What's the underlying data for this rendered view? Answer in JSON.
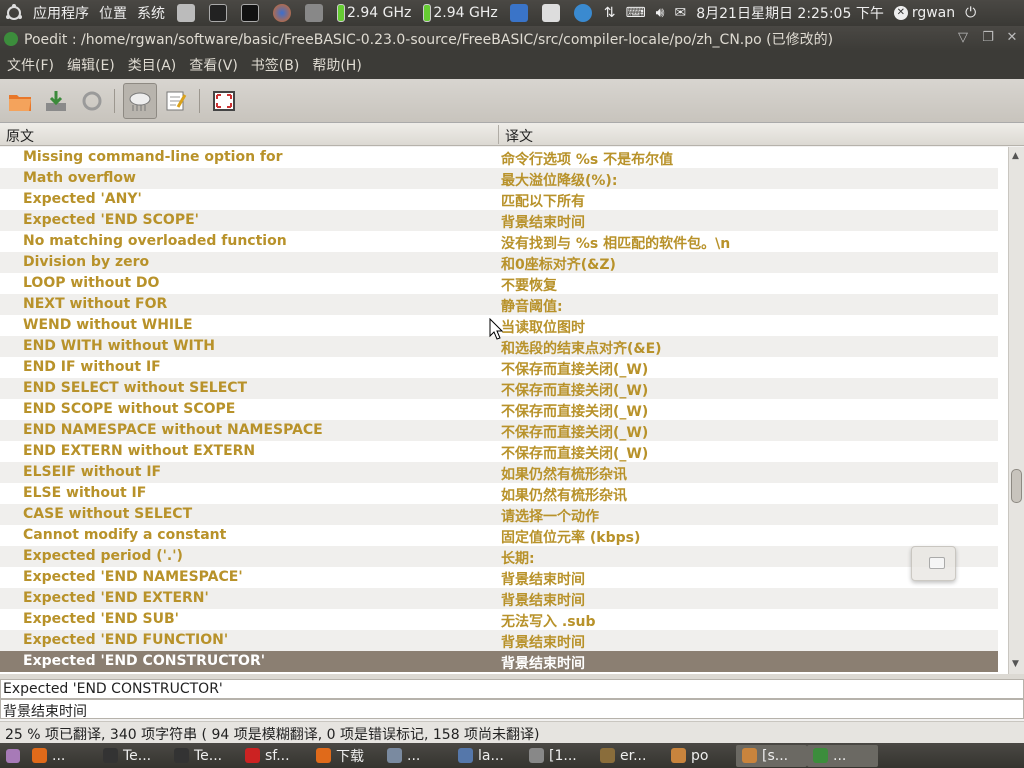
{
  "top_panel": {
    "menus": [
      "应用程序",
      "位置",
      "系统"
    ],
    "cpu1": "2.94 GHz",
    "cpu2": "2.94 GHz",
    "clock": "8月21日星期日  2:25:05 下午",
    "user": "rgwan"
  },
  "window": {
    "title": "Poedit : /home/rgwan/software/basic/FreeBASIC-0.23.0-source/FreeBASIC/src/compiler-locale/po/zh_CN.po (已修改的)"
  },
  "menubar": {
    "items": [
      "文件(F)",
      "编辑(E)",
      "类目(A)",
      "查看(V)",
      "书签(B)",
      "帮助(H)"
    ]
  },
  "columns": {
    "source": "原文",
    "translation": "译文"
  },
  "rows": [
    {
      "src": "Missing command-line option for",
      "tr": "命令行选项 %s 不是布尔值"
    },
    {
      "src": "Math overflow",
      "tr": "最大溢位降级(%):"
    },
    {
      "src": "Expected 'ANY'",
      "tr": "匹配以下所有"
    },
    {
      "src": "Expected 'END SCOPE'",
      "tr": "背景结束时间"
    },
    {
      "src": "No matching overloaded function",
      "tr": "没有找到与 %s 相匹配的软件包。\\n"
    },
    {
      "src": "Division by zero",
      "tr": "和0座标对齐(&Z)"
    },
    {
      "src": "LOOP without DO",
      "tr": "不要恢复"
    },
    {
      "src": "NEXT without FOR",
      "tr": "静音阈值:"
    },
    {
      "src": "WEND without WHILE",
      "tr": "当读取位图时"
    },
    {
      "src": "END WITH without WITH",
      "tr": "和选段的结束点对齐(&E)"
    },
    {
      "src": "END IF without IF",
      "tr": "不保存而直接关闭(_W)"
    },
    {
      "src": "END SELECT without SELECT",
      "tr": "不保存而直接关闭(_W)"
    },
    {
      "src": "END SCOPE without SCOPE",
      "tr": "不保存而直接关闭(_W)"
    },
    {
      "src": "END NAMESPACE without NAMESPACE",
      "tr": "不保存而直接关闭(_W)"
    },
    {
      "src": "END EXTERN without EXTERN",
      "tr": "不保存而直接关闭(_W)"
    },
    {
      "src": "ELSEIF without IF",
      "tr": "如果仍然有梳形杂讯"
    },
    {
      "src": "ELSE without IF",
      "tr": "如果仍然有梳形杂讯"
    },
    {
      "src": "CASE without SELECT",
      "tr": "请选择一个动作"
    },
    {
      "src": "Cannot modify a constant",
      "tr": "固定值位元率 (kbps)"
    },
    {
      "src": "Expected period ('.')",
      "tr": "长期:"
    },
    {
      "src": "Expected 'END NAMESPACE'",
      "tr": "背景结束时间"
    },
    {
      "src": "Expected 'END EXTERN'",
      "tr": "背景结束时间"
    },
    {
      "src": "Expected 'END SUB'",
      "tr": "无法写入 .sub"
    },
    {
      "src": "Expected 'END FUNCTION'",
      "tr": "背景结束时间"
    },
    {
      "src": "Expected 'END CONSTRUCTOR'",
      "tr": "背景结束时间",
      "selected": true
    }
  ],
  "editor": {
    "source_text": "Expected 'END CONSTRUCTOR'",
    "translation_text": "背景结束时间"
  },
  "status": "25 % 项已翻译, 340 项字符串 ( 94 项是模糊翻译, 0 项是错误标记, 158 项尚未翻译)",
  "taskbar": {
    "items": [
      {
        "icon": "firefox-icon",
        "label": "..."
      },
      {
        "icon": "terminal-icon",
        "label": "Te..."
      },
      {
        "icon": "terminal-icon",
        "label": "Te..."
      },
      {
        "icon": "filezilla-icon",
        "label": "sf..."
      },
      {
        "icon": "firefox-icon",
        "label": "下载"
      },
      {
        "icon": "tool-icon",
        "label": "..."
      },
      {
        "icon": "app-icon",
        "label": "la..."
      },
      {
        "icon": "editor-icon",
        "label": "[1..."
      },
      {
        "icon": "gimp-icon",
        "label": "er..."
      },
      {
        "icon": "folder-icon",
        "label": "po"
      },
      {
        "icon": "folder-icon",
        "label": "[s..."
      },
      {
        "icon": "poedit-icon",
        "label": "..."
      }
    ]
  }
}
